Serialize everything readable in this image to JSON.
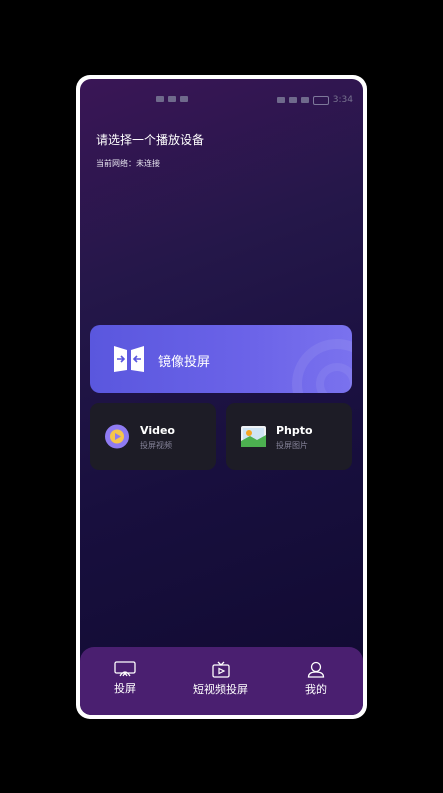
{
  "status_bar": {
    "time": "3:34"
  },
  "header": {
    "title": "请选择一个播放设备",
    "network_status": "当前网络：未连接"
  },
  "mirror_card": {
    "label": "镜像投屏"
  },
  "cards": [
    {
      "title": "Video",
      "subtitle": "投屏视频",
      "icon": "play-icon"
    },
    {
      "title": "Phpto",
      "subtitle": "投屏图片",
      "icon": "image-icon"
    }
  ],
  "tabs": [
    {
      "label": "投屏",
      "icon": "cast-icon"
    },
    {
      "label": "短视频投屏",
      "icon": "short-video-icon"
    },
    {
      "label": "我的",
      "icon": "user-icon"
    }
  ],
  "colors": {
    "mirror_card": "#6b63e8",
    "tab_bar": "#4a1f70",
    "card_bg": "#1d1c26"
  }
}
